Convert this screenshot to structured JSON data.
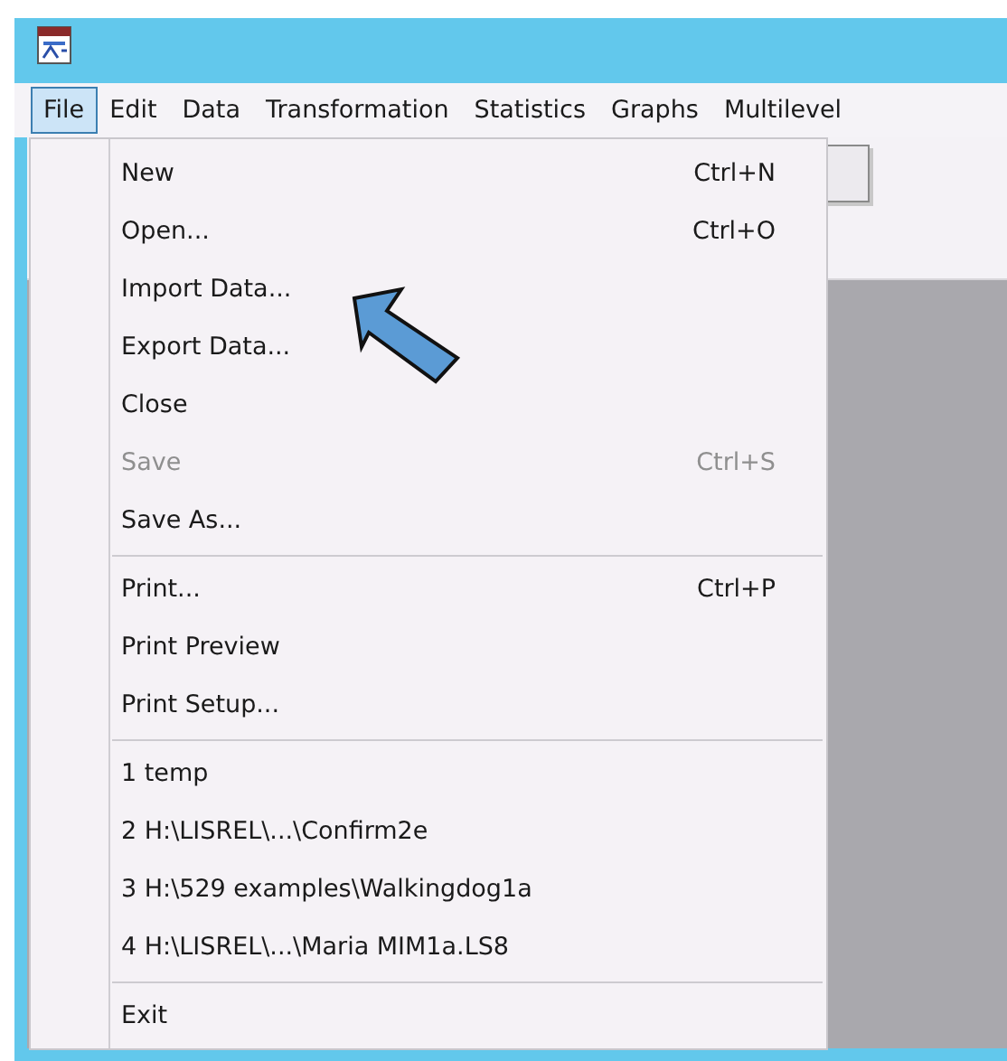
{
  "menu_bar": [
    {
      "label": "File",
      "selected": true
    },
    {
      "label": "Edit",
      "selected": false
    },
    {
      "label": "Data",
      "selected": false
    },
    {
      "label": "Transformation",
      "selected": false
    },
    {
      "label": "Statistics",
      "selected": false
    },
    {
      "label": "Graphs",
      "selected": false
    },
    {
      "label": "Multilevel",
      "selected": false
    }
  ],
  "file_menu": [
    {
      "kind": "item",
      "label": "New",
      "shortcut": "Ctrl+N",
      "disabled": false
    },
    {
      "kind": "item",
      "label": "Open...",
      "shortcut": "Ctrl+O",
      "disabled": false
    },
    {
      "kind": "item",
      "label": "Import Data...",
      "disabled": false
    },
    {
      "kind": "item",
      "label": "Export Data...",
      "disabled": false
    },
    {
      "kind": "item",
      "label": "Close",
      "disabled": false
    },
    {
      "kind": "item",
      "label": "Save",
      "shortcut": "Ctrl+S",
      "disabled": true
    },
    {
      "kind": "item",
      "label": "Save As...",
      "disabled": false
    },
    {
      "kind": "separator"
    },
    {
      "kind": "item",
      "label": "Print...",
      "shortcut": "Ctrl+P",
      "disabled": false
    },
    {
      "kind": "item",
      "label": "Print Preview",
      "disabled": false
    },
    {
      "kind": "item",
      "label": "Print Setup...",
      "disabled": false
    },
    {
      "kind": "separator"
    },
    {
      "kind": "item",
      "label": "1 temp",
      "disabled": false
    },
    {
      "kind": "item",
      "label": "2 H:\\LISREL\\...\\Confirm2e",
      "disabled": false
    },
    {
      "kind": "item",
      "label": "3 H:\\529 examples\\Walkingdog1a",
      "disabled": false
    },
    {
      "kind": "item",
      "label": "4 H:\\LISREL\\...\\Maria MIM1a.LS8",
      "disabled": false
    },
    {
      "kind": "separator"
    },
    {
      "kind": "item",
      "label": "Exit",
      "disabled": false
    }
  ]
}
